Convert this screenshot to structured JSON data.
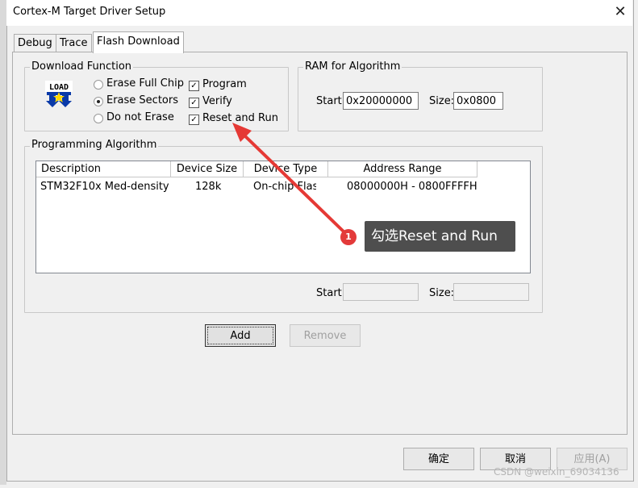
{
  "window": {
    "title": "Cortex-M Target Driver Setup",
    "close_label": "✕"
  },
  "tabs": [
    {
      "label": "Debug"
    },
    {
      "label": "Trace"
    },
    {
      "label": "Flash Download",
      "active": true
    }
  ],
  "download_function": {
    "legend": "Download Function",
    "icon_text": "LOAD",
    "erase_options": [
      {
        "label": "Erase Full Chip",
        "selected": false
      },
      {
        "label": "Erase Sectors",
        "selected": true
      },
      {
        "label": "Do not Erase",
        "selected": false
      }
    ],
    "checks": [
      {
        "label": "Program",
        "checked": true
      },
      {
        "label": "Verify",
        "checked": true
      },
      {
        "label": "Reset and Run",
        "checked": true
      }
    ]
  },
  "ram": {
    "legend": "RAM for Algorithm",
    "start_label": "Start:",
    "start_value": "0x20000000",
    "size_label": "Size:",
    "size_value": "0x0800"
  },
  "programming_algorithm": {
    "legend": "Programming Algorithm",
    "columns": [
      "Description",
      "Device Size",
      "Device Type",
      "Address Range"
    ],
    "rows": [
      {
        "description": "STM32F10x Med-density ...",
        "size": "128k",
        "type": "On-chip Flash",
        "range": "08000000H - 0800FFFFH"
      }
    ],
    "start_label": "Start:",
    "start_value": "",
    "size_label": "Size:",
    "size_value": ""
  },
  "buttons": {
    "add": "Add",
    "remove": "Remove",
    "ok": "确定",
    "cancel": "取消",
    "apply": "应用(A)"
  },
  "annotation": {
    "number": "1",
    "text": "勾选Reset and Run"
  },
  "watermark": "CSDN @weixin_69034136",
  "colors": {
    "arrow": "#e53935",
    "badge": "#e33a3a",
    "callout_bg": "#4e4e4e"
  }
}
